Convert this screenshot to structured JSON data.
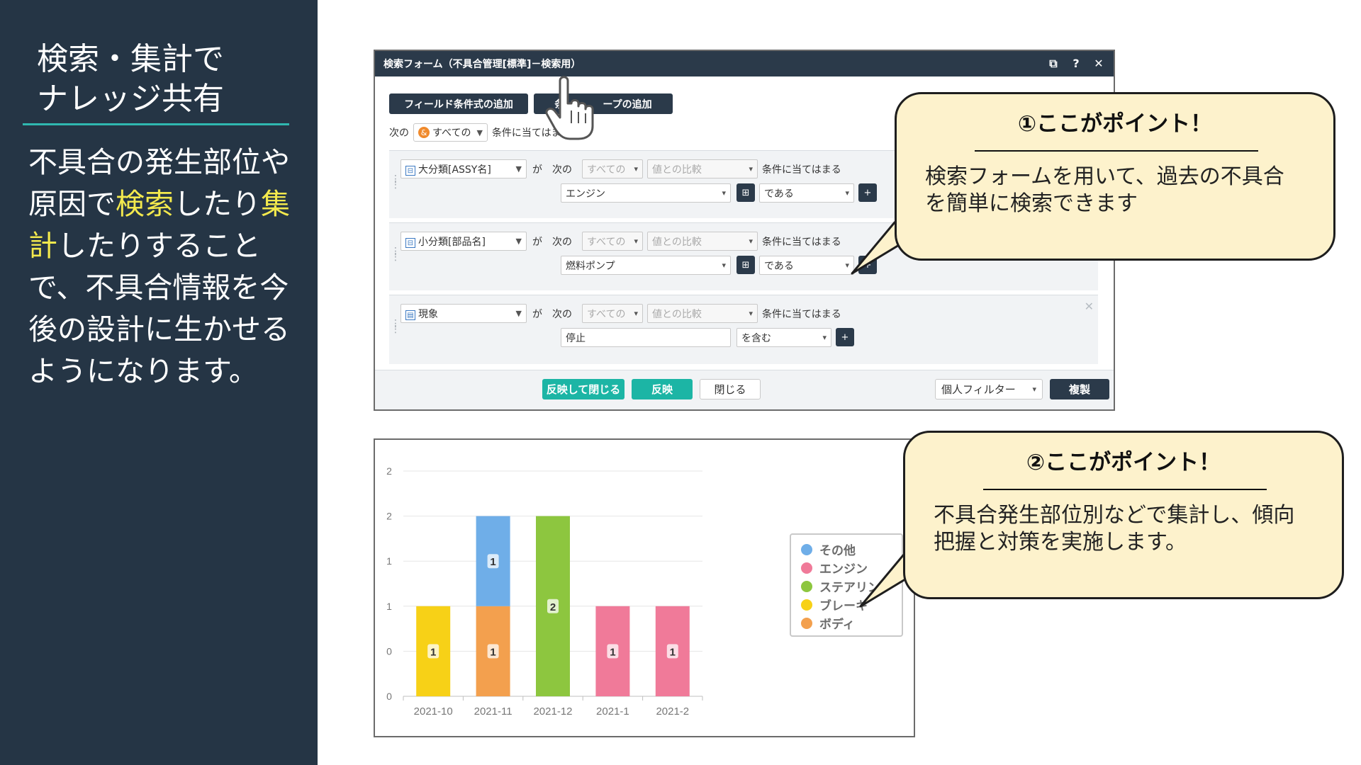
{
  "left": {
    "title_line1": "検索・集計で",
    "title_line2": "ナレッジ共有",
    "body": [
      {
        "t": "不具合の発生部位や",
        "h": false
      },
      {
        "t": "原因で",
        "h": false
      },
      {
        "t": "検索",
        "h": true
      },
      {
        "t": "したり",
        "h": false
      },
      {
        "t": "集",
        "h": true
      },
      {
        "t": "計",
        "h": true
      },
      {
        "t": "したりすること",
        "h": false
      },
      {
        "t": "で、不具合情報を今",
        "h": false
      },
      {
        "t": "後の設計に生かせる",
        "h": false
      },
      {
        "t": "ようになります。",
        "h": false
      }
    ]
  },
  "form": {
    "title": "検索フォーム（不具合管理[標準]－検索用）",
    "titlebar_icons": [
      "expand-icon",
      "help-icon",
      "close-icon"
    ],
    "btn_add_field": "フィールド条件式の追加",
    "btn_add_group_visible": "条",
    "btn_add_group_tail": "ープの追加",
    "match_prefix": "次の",
    "match_value": "すべての",
    "match_suffix": "条件に当てはま",
    "conditions": [
      {
        "field": "大分類[ASSY名]",
        "ga": "が",
        "tsugi": "次の",
        "all": "すべての",
        "compare": "値との比較",
        "suffix": "条件に当てはまる",
        "value": "エンジン",
        "op": "である"
      },
      {
        "field": "小分類[部品名]",
        "ga": "が",
        "tsugi": "次の",
        "all": "すべての",
        "compare": "値との比較",
        "suffix": "条件に当てはまる",
        "value": "燃料ポンプ",
        "op": "である"
      },
      {
        "field": "現象",
        "ga": "が",
        "tsugi": "次の",
        "all": "すべての",
        "compare": "値との比較",
        "suffix": "条件に当てはまる",
        "value": "停止",
        "op": "を含む"
      }
    ],
    "footer": {
      "apply_close": "反映して閉じる",
      "apply": "反映",
      "close": "閉じる",
      "filter": "個人フィルター",
      "duplicate": "複製"
    }
  },
  "callout1": {
    "title": "①ここがポイント！",
    "text_line1": "検索フォームを用いて、過去の不具合",
    "text_line2": "を簡単に検索できます"
  },
  "callout2": {
    "title": "②ここがポイント！",
    "text_line1": "不具合発生部位別などで集計し、傾向",
    "text_line2": "把握と対策を実施します。"
  },
  "colors": {
    "navy": "#253545",
    "teal": "#1cb5a5",
    "highlight": "#f3e94d",
    "callout_bg": "#fdf2cc"
  },
  "chart_data": {
    "type": "bar",
    "stacked": true,
    "categories": [
      "2021-10",
      "2021-11",
      "2021-12",
      "2021-1",
      "2021-2"
    ],
    "y_tick_labels": [
      "0",
      "0",
      "1",
      "1",
      "2",
      "2"
    ],
    "ylim": [
      0,
      2.5
    ],
    "grid": true,
    "legend_position": "right",
    "series": [
      {
        "name": "その他",
        "color": "#6faee8",
        "values": [
          0,
          1,
          0,
          0,
          0
        ]
      },
      {
        "name": "エンジン",
        "color": "#f07a99",
        "values": [
          0,
          0,
          0,
          1,
          1
        ]
      },
      {
        "name": "ステアリング",
        "color": "#8dc63f",
        "values": [
          0,
          0,
          2,
          0,
          0
        ]
      },
      {
        "name": "ブレーキ",
        "color": "#f7d117",
        "values": [
          1,
          0,
          0,
          0,
          0
        ]
      },
      {
        "name": "ボディ",
        "color": "#f3a04e",
        "values": [
          0,
          1,
          0,
          0,
          0
        ]
      }
    ],
    "legend_visible": [
      "その他",
      "エンジン",
      "ステアリン",
      "ブレーキ",
      "ボディ"
    ],
    "stack_order": [
      "ボディ",
      "ブレーキ",
      "ステアリング",
      "エンジン",
      "その他"
    ]
  }
}
